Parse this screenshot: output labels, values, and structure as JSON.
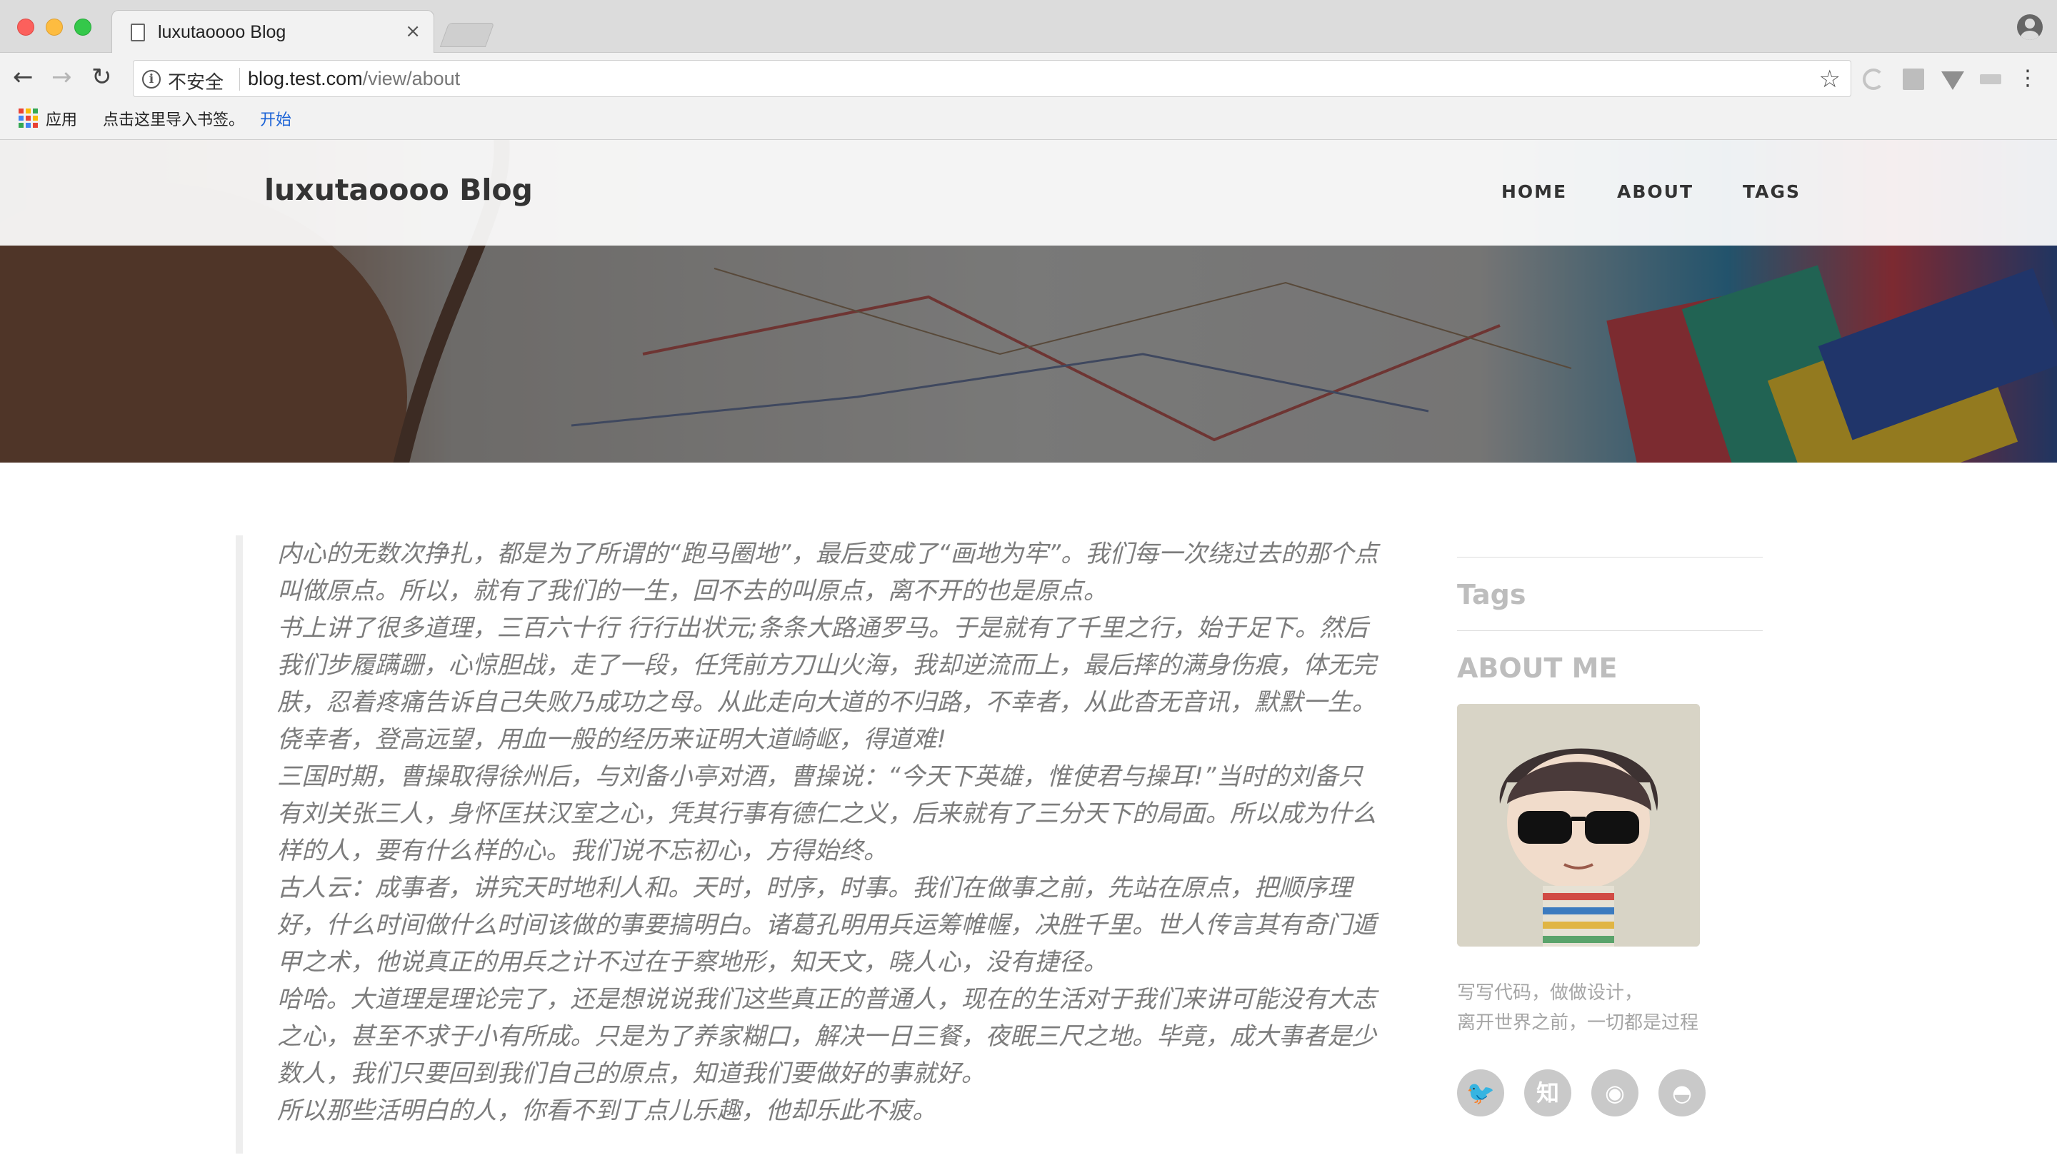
{
  "browser": {
    "tab_title": "luxutaoooo Blog",
    "tab_close": "×",
    "security_label": "不安全",
    "url_host": "blog.test.com",
    "url_path": "/view/about",
    "bookmarks": {
      "apps": "应用",
      "import": "点击这里导入书签。",
      "start": "开始"
    }
  },
  "site": {
    "brand": "luxutaoooo Blog",
    "nav": {
      "home": "HOME",
      "about": "ABOUT",
      "tags": "TAGS"
    }
  },
  "content": {
    "paragraphs": [
      "内心的无数次挣扎，都是为了所谓的“跑马圈地”，最后变成了“画地为牢”。我们每一次绕过去的那个点叫做原点。所以，就有了我们的一生，回不去的叫原点，离不开的也是原点。",
      "书上讲了很多道理，三百六十行 行行出状元;条条大路通罗马。于是就有了千里之行，始于足下。然后我们步履蹒跚，心惊胆战，走了一段，任凭前方刀山火海，我却逆流而上，最后摔的满身伤痕，体无完肤，忍着疼痛告诉自己失败乃成功之母。从此走向大道的不归路，不幸者，从此杳无音讯，默默一生。侥幸者，登高远望，用血一般的经历来证明大道崎岖，得道难!",
      "三国时期，曹操取得徐州后，与刘备小亭对酒，曹操说：“今天下英雄，惟使君与操耳!”当时的刘备只有刘关张三人，身怀匡扶汉室之心，凭其行事有德仁之义，后来就有了三分天下的局面。所以成为什么样的人，要有什么样的心。我们说不忘初心，方得始终。",
      "古人云：成事者，讲究天时地利人和。天时，时序，时事。我们在做事之前，先站在原点，把顺序理好，什么时间做什么时间该做的事要搞明白。诸葛孔明用兵运筹帷幄，决胜千里。世人传言其有奇门遁甲之术，他说真正的用兵之计不过在于察地形，知天文，晓人心，没有捷径。",
      "哈哈。大道理是理论完了，还是想说说我们这些真正的普通人，现在的生活对于我们来讲可能没有大志之心，甚至不求于小有所成。只是为了养家糊口，解决一日三餐，夜眠三尺之地。毕竟，成大事者是少数人，我们只要回到我们自己的原点，知道我们要做好的事就好。",
      "所以那些活明白的人，你看不到丁点儿乐趣，他却乐此不疲。"
    ]
  },
  "sidebar": {
    "tags_title": "Tags",
    "about_title": "ABOUT ME",
    "description_line1": "写写代码，做做设计，",
    "description_line2": "离开世界之前，一切都是过程",
    "social": [
      {
        "icon": "twitter-icon",
        "glyph": "🐦"
      },
      {
        "icon": "zhihu-icon",
        "glyph": "知"
      },
      {
        "icon": "weibo-icon",
        "glyph": "◉"
      },
      {
        "icon": "github-icon",
        "glyph": "◓"
      }
    ]
  },
  "colors": {
    "quote_text": "#7c7c7c",
    "sidebar_title": "#bdbdbd",
    "link_blue": "#1a62d6"
  }
}
